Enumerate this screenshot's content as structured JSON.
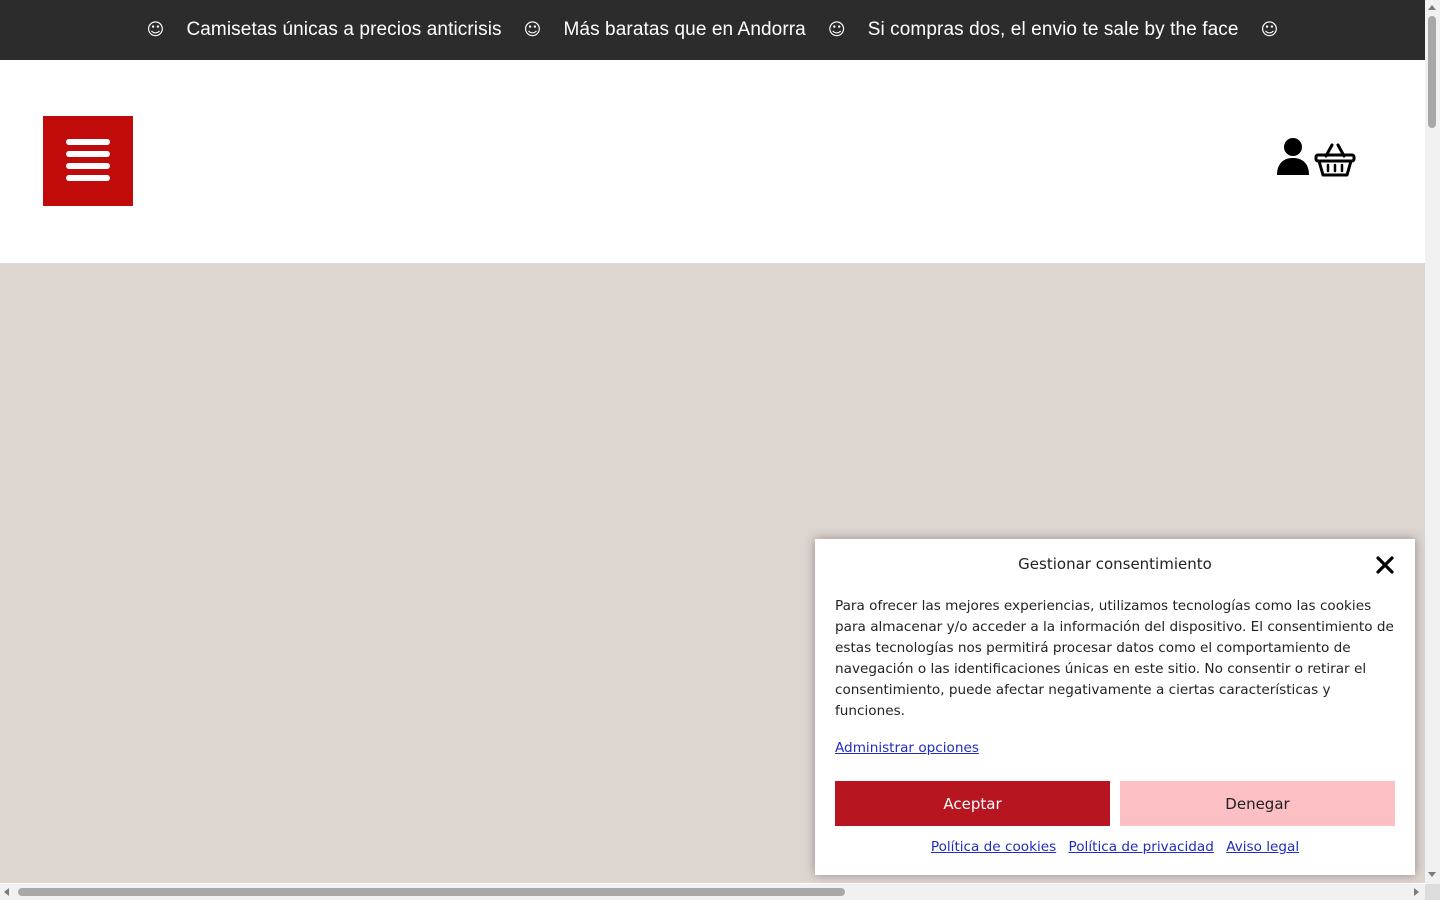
{
  "announcement_bar": {
    "separator_icon": "smiley-icon",
    "separator_glyph": "☺",
    "messages": [
      "Camisetas únicas a precios anticrisis",
      "Más baratas que en Andorra",
      "Si compras dos, el envio te sale by the face"
    ],
    "background": "#2c2c2c",
    "text_color": "#ffffff"
  },
  "header": {
    "menu_button": {
      "icon": "hamburger-menu-icon",
      "color": "#c10b0b"
    },
    "account_icon": "user-icon",
    "cart_icon": "shopping-basket-icon"
  },
  "hero": {
    "background": "#ddd5d0"
  },
  "cookie_banner": {
    "title": "Gestionar consentimiento",
    "close_icon": "close-icon",
    "body": "Para ofrecer las mejores experiencias, utilizamos tecnologías como las cookies para almacenar y/o acceder a la información del dispositivo. El consentimiento de estas tecnologías nos permitirá procesar datos como el comportamiento de navegación o las identificaciones únicas en este sitio. No consentir o retirar el consentimiento, puede afectar negativamente a ciertas características y funciones.",
    "manage_link": "Administrar opciones",
    "accept_label": "Aceptar",
    "deny_label": "Denegar",
    "accept_color": "#b71520",
    "deny_color": "#fbbfc4",
    "links": [
      "Política de cookies",
      "Política de privacidad",
      "Aviso legal"
    ]
  }
}
